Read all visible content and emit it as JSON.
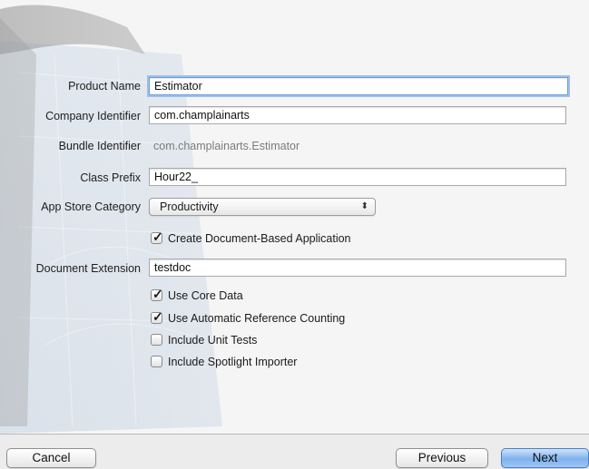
{
  "form": {
    "product_name": {
      "label": "Product Name",
      "value": "Estimator"
    },
    "company_identifier": {
      "label": "Company Identifier",
      "value": "com.champlainarts"
    },
    "bundle_identifier": {
      "label": "Bundle Identifier",
      "value": "com.champlainarts.Estimator"
    },
    "class_prefix": {
      "label": "Class Prefix",
      "value": "Hour22_"
    },
    "app_store_category": {
      "label": "App Store Category",
      "value": "Productivity",
      "icon": "updown-arrows-icon"
    },
    "create_document_based": {
      "label": "Create Document-Based Application",
      "checked": true
    },
    "document_extension": {
      "label": "Document Extension",
      "value": "testdoc"
    },
    "use_core_data": {
      "label": "Use Core Data",
      "checked": true
    },
    "use_arc": {
      "label": "Use Automatic Reference Counting",
      "checked": true
    },
    "include_unit_tests": {
      "label": "Include Unit Tests",
      "checked": false
    },
    "include_spotlight": {
      "label": "Include Spotlight Importer",
      "checked": false
    }
  },
  "buttons": {
    "cancel": "Cancel",
    "previous": "Previous",
    "next": "Next"
  },
  "colors": {
    "focus_ring": "#9cc0ec",
    "default_button": "#7fb1ee"
  }
}
